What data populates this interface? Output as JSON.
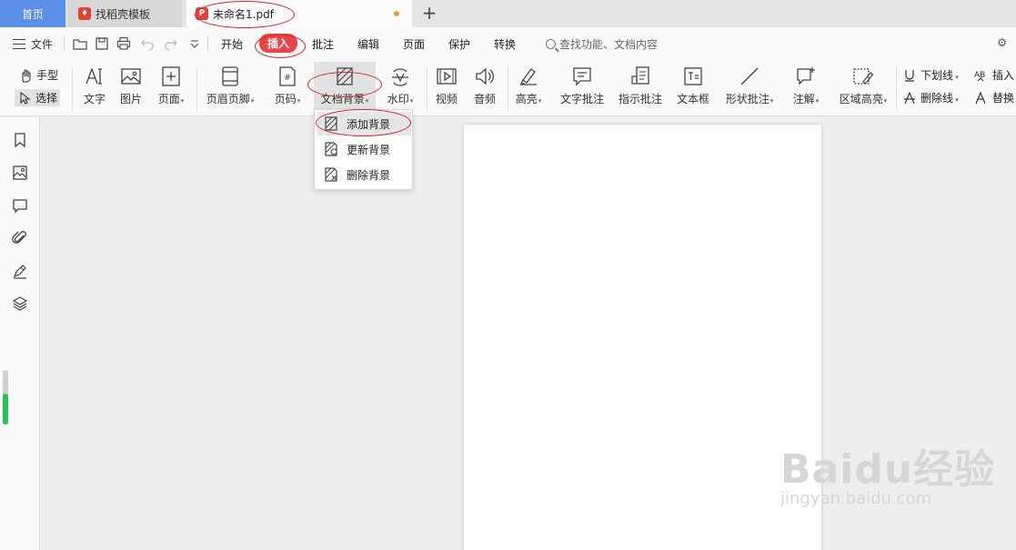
{
  "tabs": {
    "home": "首页",
    "template": "找稻壳模板",
    "document": "未命名1.pdf"
  },
  "menu": {
    "file": "文件",
    "tabs": [
      "开始",
      "插入",
      "批注",
      "编辑",
      "页面",
      "保护",
      "转换"
    ],
    "active_tab": "插入",
    "search_placeholder": "查找功能、文档内容"
  },
  "ribbon": {
    "hand_tool": "手型",
    "select_tool": "选择",
    "text": "文字",
    "image": "图片",
    "page": "页面",
    "header_footer": "页眉页脚",
    "page_number": "页码",
    "doc_background": "文档背景",
    "watermark": "水印",
    "video": "视频",
    "audio": "音频",
    "highlight": "高亮",
    "text_comment": "文字批注",
    "pointer_comment": "指示批注",
    "text_box": "文本框",
    "shape_comment": "形状批注",
    "note": "注解",
    "area_highlight": "区域高亮",
    "underline": "下划线",
    "strikethrough": "删除线",
    "insert_text": "插入",
    "replace_text": "替换"
  },
  "background_menu": {
    "items": [
      "添加背景",
      "更新背景",
      "删除背景"
    ],
    "hovered": "添加背景"
  },
  "sidebar": {
    "icons": [
      "bookmark-icon",
      "thumbnail-icon",
      "comment-icon",
      "attachment-icon",
      "signature-icon",
      "layers-icon"
    ]
  },
  "watermark_text": {
    "brand": "Baidu经验",
    "url": "jingyan.baidu.com"
  },
  "colors": {
    "accent": "#5b8ee6",
    "active_tab": "#e8464a",
    "annotation": "#d9222a",
    "unsaved_dot": "#e8a11c",
    "scroll_green": "#27c252"
  }
}
